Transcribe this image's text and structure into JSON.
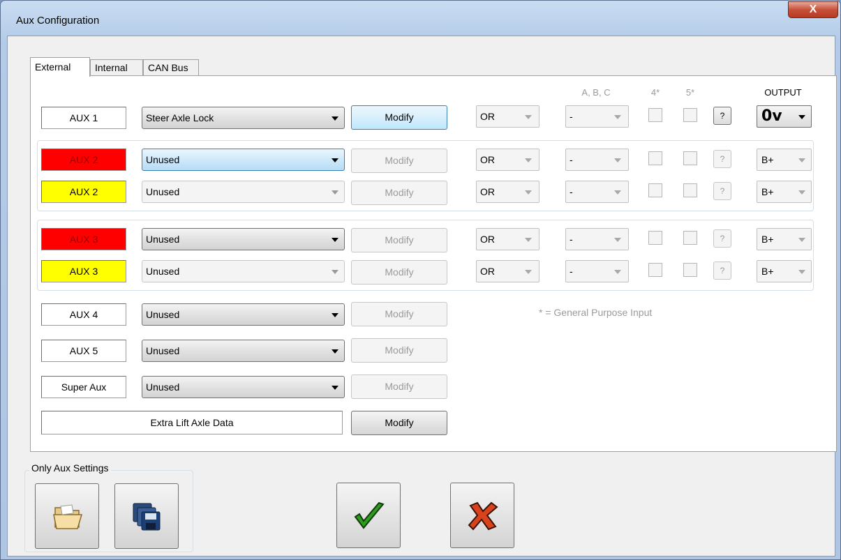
{
  "window": {
    "title": "Aux Configuration",
    "close_label": "X"
  },
  "tabs": [
    {
      "label": "External"
    },
    {
      "label": "Internal"
    },
    {
      "label": "CAN Bus"
    }
  ],
  "headers": {
    "abc": "A, B, C",
    "in4": "4*",
    "in5": "5*",
    "output": "OUTPUT"
  },
  "rows": [
    {
      "label": "AUX 1",
      "function": "Steer Axle Lock",
      "modify": "Modify",
      "logic": "OR",
      "abc": "-",
      "help": "?",
      "output": "0v"
    },
    {
      "label": "AUX 2",
      "function": "Unused",
      "modify": "Modify",
      "logic": "OR",
      "abc": "-",
      "help": "?",
      "output": "B+"
    },
    {
      "label": "AUX 2",
      "function": "Unused",
      "modify": "Modify",
      "logic": "OR",
      "abc": "-",
      "help": "?",
      "output": "B+"
    },
    {
      "label": "AUX 3",
      "function": "Unused",
      "modify": "Modify",
      "logic": "OR",
      "abc": "-",
      "help": "?",
      "output": "B+"
    },
    {
      "label": "AUX 3",
      "function": "Unused",
      "modify": "Modify",
      "logic": "OR",
      "abc": "-",
      "help": "?",
      "output": "B+"
    },
    {
      "label": "AUX 4",
      "function": "Unused",
      "modify": "Modify"
    },
    {
      "label": "AUX 5",
      "function": "Unused",
      "modify": "Modify"
    },
    {
      "label": "Super Aux",
      "function": "Unused",
      "modify": "Modify"
    }
  ],
  "note": "* =  General Purpose Input",
  "extra": {
    "label": "Extra Lift Axle Data",
    "modify": "Modify"
  },
  "settings": {
    "legend": "Only Aux Settings"
  },
  "colors": {
    "red": "#ff0000",
    "yellow": "#ffff00",
    "ok": "#2e9a1f",
    "cancel": "#d9431c"
  },
  "icons": {
    "open": "folder-open-icon",
    "save": "save-disks-icon",
    "ok": "checkmark-icon",
    "cancel": "cross-icon"
  }
}
